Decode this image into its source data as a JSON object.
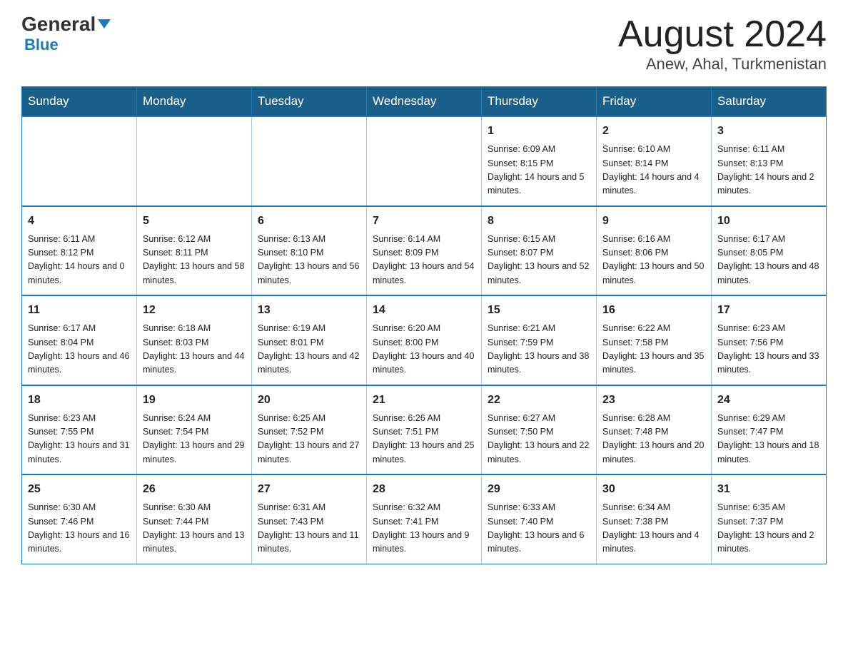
{
  "header": {
    "logo_general": "General",
    "logo_blue": "Blue",
    "title": "August 2024",
    "subtitle": "Anew, Ahal, Turkmenistan"
  },
  "days_of_week": [
    "Sunday",
    "Monday",
    "Tuesday",
    "Wednesday",
    "Thursday",
    "Friday",
    "Saturday"
  ],
  "weeks": [
    [
      {
        "day": "",
        "info": ""
      },
      {
        "day": "",
        "info": ""
      },
      {
        "day": "",
        "info": ""
      },
      {
        "day": "",
        "info": ""
      },
      {
        "day": "1",
        "info": "Sunrise: 6:09 AM\nSunset: 8:15 PM\nDaylight: 14 hours and 5 minutes."
      },
      {
        "day": "2",
        "info": "Sunrise: 6:10 AM\nSunset: 8:14 PM\nDaylight: 14 hours and 4 minutes."
      },
      {
        "day": "3",
        "info": "Sunrise: 6:11 AM\nSunset: 8:13 PM\nDaylight: 14 hours and 2 minutes."
      }
    ],
    [
      {
        "day": "4",
        "info": "Sunrise: 6:11 AM\nSunset: 8:12 PM\nDaylight: 14 hours and 0 minutes."
      },
      {
        "day": "5",
        "info": "Sunrise: 6:12 AM\nSunset: 8:11 PM\nDaylight: 13 hours and 58 minutes."
      },
      {
        "day": "6",
        "info": "Sunrise: 6:13 AM\nSunset: 8:10 PM\nDaylight: 13 hours and 56 minutes."
      },
      {
        "day": "7",
        "info": "Sunrise: 6:14 AM\nSunset: 8:09 PM\nDaylight: 13 hours and 54 minutes."
      },
      {
        "day": "8",
        "info": "Sunrise: 6:15 AM\nSunset: 8:07 PM\nDaylight: 13 hours and 52 minutes."
      },
      {
        "day": "9",
        "info": "Sunrise: 6:16 AM\nSunset: 8:06 PM\nDaylight: 13 hours and 50 minutes."
      },
      {
        "day": "10",
        "info": "Sunrise: 6:17 AM\nSunset: 8:05 PM\nDaylight: 13 hours and 48 minutes."
      }
    ],
    [
      {
        "day": "11",
        "info": "Sunrise: 6:17 AM\nSunset: 8:04 PM\nDaylight: 13 hours and 46 minutes."
      },
      {
        "day": "12",
        "info": "Sunrise: 6:18 AM\nSunset: 8:03 PM\nDaylight: 13 hours and 44 minutes."
      },
      {
        "day": "13",
        "info": "Sunrise: 6:19 AM\nSunset: 8:01 PM\nDaylight: 13 hours and 42 minutes."
      },
      {
        "day": "14",
        "info": "Sunrise: 6:20 AM\nSunset: 8:00 PM\nDaylight: 13 hours and 40 minutes."
      },
      {
        "day": "15",
        "info": "Sunrise: 6:21 AM\nSunset: 7:59 PM\nDaylight: 13 hours and 38 minutes."
      },
      {
        "day": "16",
        "info": "Sunrise: 6:22 AM\nSunset: 7:58 PM\nDaylight: 13 hours and 35 minutes."
      },
      {
        "day": "17",
        "info": "Sunrise: 6:23 AM\nSunset: 7:56 PM\nDaylight: 13 hours and 33 minutes."
      }
    ],
    [
      {
        "day": "18",
        "info": "Sunrise: 6:23 AM\nSunset: 7:55 PM\nDaylight: 13 hours and 31 minutes."
      },
      {
        "day": "19",
        "info": "Sunrise: 6:24 AM\nSunset: 7:54 PM\nDaylight: 13 hours and 29 minutes."
      },
      {
        "day": "20",
        "info": "Sunrise: 6:25 AM\nSunset: 7:52 PM\nDaylight: 13 hours and 27 minutes."
      },
      {
        "day": "21",
        "info": "Sunrise: 6:26 AM\nSunset: 7:51 PM\nDaylight: 13 hours and 25 minutes."
      },
      {
        "day": "22",
        "info": "Sunrise: 6:27 AM\nSunset: 7:50 PM\nDaylight: 13 hours and 22 minutes."
      },
      {
        "day": "23",
        "info": "Sunrise: 6:28 AM\nSunset: 7:48 PM\nDaylight: 13 hours and 20 minutes."
      },
      {
        "day": "24",
        "info": "Sunrise: 6:29 AM\nSunset: 7:47 PM\nDaylight: 13 hours and 18 minutes."
      }
    ],
    [
      {
        "day": "25",
        "info": "Sunrise: 6:30 AM\nSunset: 7:46 PM\nDaylight: 13 hours and 16 minutes."
      },
      {
        "day": "26",
        "info": "Sunrise: 6:30 AM\nSunset: 7:44 PM\nDaylight: 13 hours and 13 minutes."
      },
      {
        "day": "27",
        "info": "Sunrise: 6:31 AM\nSunset: 7:43 PM\nDaylight: 13 hours and 11 minutes."
      },
      {
        "day": "28",
        "info": "Sunrise: 6:32 AM\nSunset: 7:41 PM\nDaylight: 13 hours and 9 minutes."
      },
      {
        "day": "29",
        "info": "Sunrise: 6:33 AM\nSunset: 7:40 PM\nDaylight: 13 hours and 6 minutes."
      },
      {
        "day": "30",
        "info": "Sunrise: 6:34 AM\nSunset: 7:38 PM\nDaylight: 13 hours and 4 minutes."
      },
      {
        "day": "31",
        "info": "Sunrise: 6:35 AM\nSunset: 7:37 PM\nDaylight: 13 hours and 2 minutes."
      }
    ]
  ]
}
